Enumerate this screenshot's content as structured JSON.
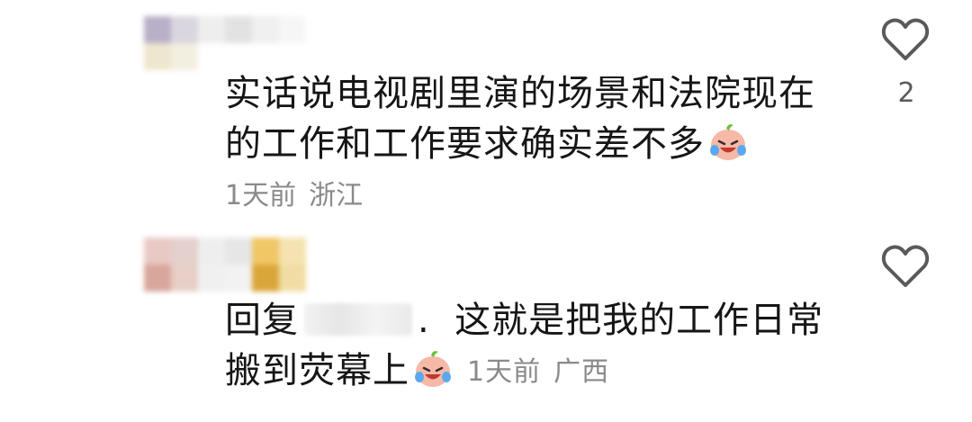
{
  "comments": [
    {
      "text": "实话说电视剧里演的场景和法院现在的工作和工作要求确实差不多",
      "time": "1天前",
      "location": "浙江",
      "likes": "2",
      "emoji": "crying-laughing-emoji"
    },
    {
      "reply_prefix": "回复",
      "reply_sep": ".",
      "text": "这就是把我的工作日常搬到荧幕上",
      "time": "1天前",
      "location": "广西",
      "emoji": "crying-laughing-emoji"
    }
  ],
  "icons": {
    "like": "heart-outline-icon"
  },
  "colors": {
    "text": "#161616",
    "meta": "#8a8a8a",
    "icon": "#5a5a5a"
  }
}
